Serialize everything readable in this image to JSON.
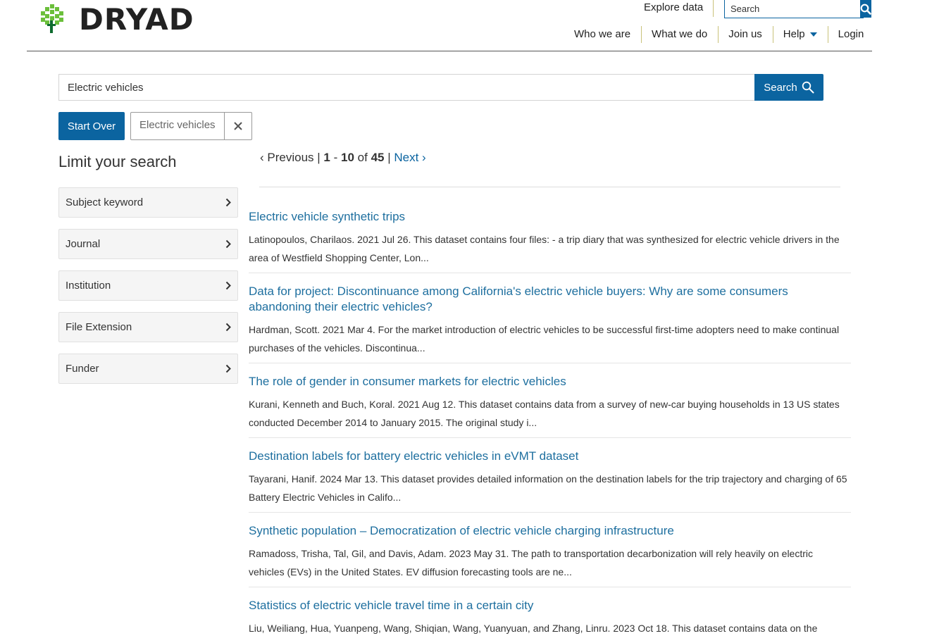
{
  "header": {
    "logo_text": "DRYAD",
    "explore": "Explore data",
    "search_placeholder": "Search",
    "nav": {
      "who": "Who we are",
      "what": "What we do",
      "join": "Join us",
      "help": "Help",
      "login": "Login"
    }
  },
  "search": {
    "value": "Electric vehicles",
    "button": "Search"
  },
  "start_over": "Start Over",
  "filter_chip": "Electric vehicles",
  "sidebar": {
    "title": "Limit your search",
    "facets": [
      "Subject keyword",
      "Journal",
      "Institution",
      "File Extension",
      "Funder"
    ]
  },
  "pagination": {
    "previous": "‹ Previous",
    "start": "1",
    "end": "10",
    "of": "of",
    "total": "45",
    "next": "Next ›"
  },
  "results": [
    {
      "title": "Electric vehicle synthetic trips",
      "description": "Latinopoulos, Charilaos. 2021 Jul 26. This dataset contains four files: - a trip diary that was synthesized for electric vehicle drivers in the area of Westfield Shopping Center, Lon..."
    },
    {
      "title": "Data for project: Discontinuance among California's electric vehicle buyers: Why are some consumers abandoning their electric vehicles?",
      "description": "Hardman, Scott. 2021 Mar 4. For the market introduction of electric vehicles to be successful first-time adopters need to make continual purchases of the vehicles. Discontinua..."
    },
    {
      "title": "The role of gender in consumer markets for electric vehicles",
      "description": "Kurani, Kenneth and Buch, Koral. 2021 Aug 12. This dataset contains data from a survey of new-car buying households in 13 US states conducted December 2014 to January 2015. The original study i..."
    },
    {
      "title": "Destination labels for battery electric vehicles in eVMT dataset",
      "description": "Tayarani, Hanif. 2024 Mar 13. This dataset provides detailed information on the destination labels for the trip trajectory and charging of 65 Battery Electric Vehicles in Califo..."
    },
    {
      "title": "Synthetic population – Democratization of electric vehicle charging infrastructure",
      "description": "Ramadoss, Trisha, Tal, Gil, and Davis, Adam. 2023 May 31. The path to transportation decarbonization will rely heavily on electric vehicles (EVs) in the United States. EV diffusion forecasting tools are ne..."
    },
    {
      "title": "Statistics of electric vehicle travel time in a certain city",
      "description": "Liu, Weiliang, Hua, Yuanpeng, Wang, Shiqian, Wang, Yuanyuan, and Zhang, Linru. 2023 Oct 18. This dataset contains data on the"
    }
  ],
  "colors": {
    "brand_blue": "#0b64a0",
    "link": "#1e6f9f",
    "logo_green": "#6bbf3b"
  }
}
